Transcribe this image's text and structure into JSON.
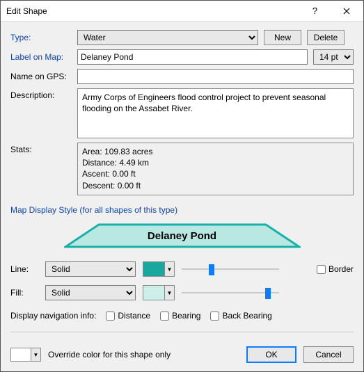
{
  "window": {
    "title": "Edit Shape"
  },
  "labels": {
    "type": "Type:",
    "label_on_map": "Label on Map:",
    "name_on_gps": "Name on GPS:",
    "description": "Description:",
    "stats": "Stats:",
    "group": "Map Display Style (for all shapes of this type)",
    "line": "Line:",
    "fill": "Fill:",
    "border": "Border",
    "nav": "Display navigation info:",
    "distance": "Distance",
    "bearing": "Bearing",
    "back_bearing": "Back Bearing",
    "override": "Override color for this shape only"
  },
  "buttons": {
    "new": "New",
    "delete": "Delete",
    "ok": "OK",
    "cancel": "Cancel"
  },
  "fields": {
    "type_value": "Water",
    "label_value": "Delaney Pond",
    "pt_value": "14 pt",
    "gps_value": "",
    "description_value": "Army Corps of Engineers flood control project to prevent seasonal flooding on the Assabet River.",
    "stats_value": "Area: 109.83 acres\nDistance: 4.49 km\nAscent: 0.00 ft\nDescent: 0.00 ft",
    "line_style": "Solid",
    "fill_style": "Solid"
  },
  "preview": {
    "caption": "Delaney Pond",
    "stroke": "#18b0a8",
    "fill": "#b9e8e3"
  },
  "colors": {
    "line_swatch": "#18a8a0",
    "fill_swatch": "#cdeee9"
  },
  "sliders": {
    "line_pos_pct": 28,
    "fill_pos_pct": 86
  }
}
